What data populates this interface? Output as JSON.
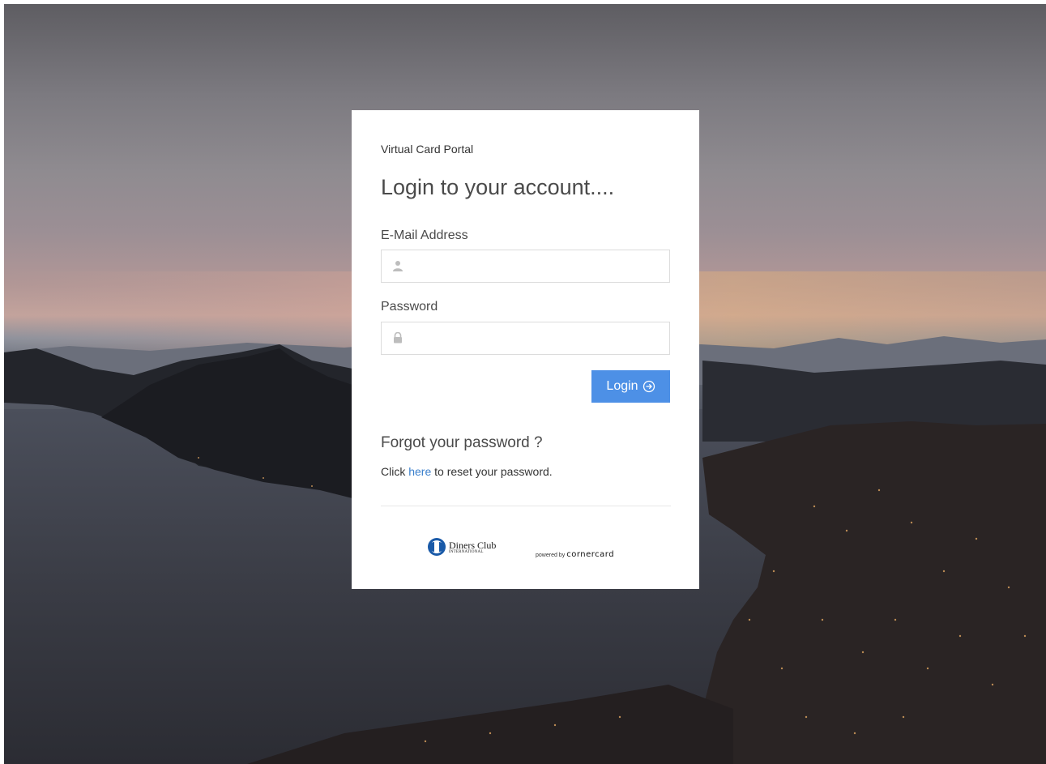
{
  "card": {
    "portal_name": "Virtual Card Portal",
    "title": "Login to your account....",
    "email_label": "E-Mail Address",
    "email_value": "",
    "password_label": "Password",
    "password_value": "",
    "login_button": "Login",
    "forgot_title": "Forgot your password ?",
    "reset_prefix": "Click ",
    "reset_link": "here",
    "reset_suffix": " to reset your password."
  },
  "footer": {
    "diners_line1": "Diners Club",
    "diners_line2": "INTERNATIONAL",
    "powered_prefix": "powered by",
    "powered_brand": "cornercard"
  },
  "icons": {
    "email_icon": "user-icon",
    "password_icon": "lock-icon",
    "login_icon": "circle-arrow-right-icon",
    "brand_icon": "diners-club-logo-icon"
  },
  "colors": {
    "accent": "#4d90e6",
    "link": "#3a7fcc",
    "card_background": "#ffffff"
  }
}
